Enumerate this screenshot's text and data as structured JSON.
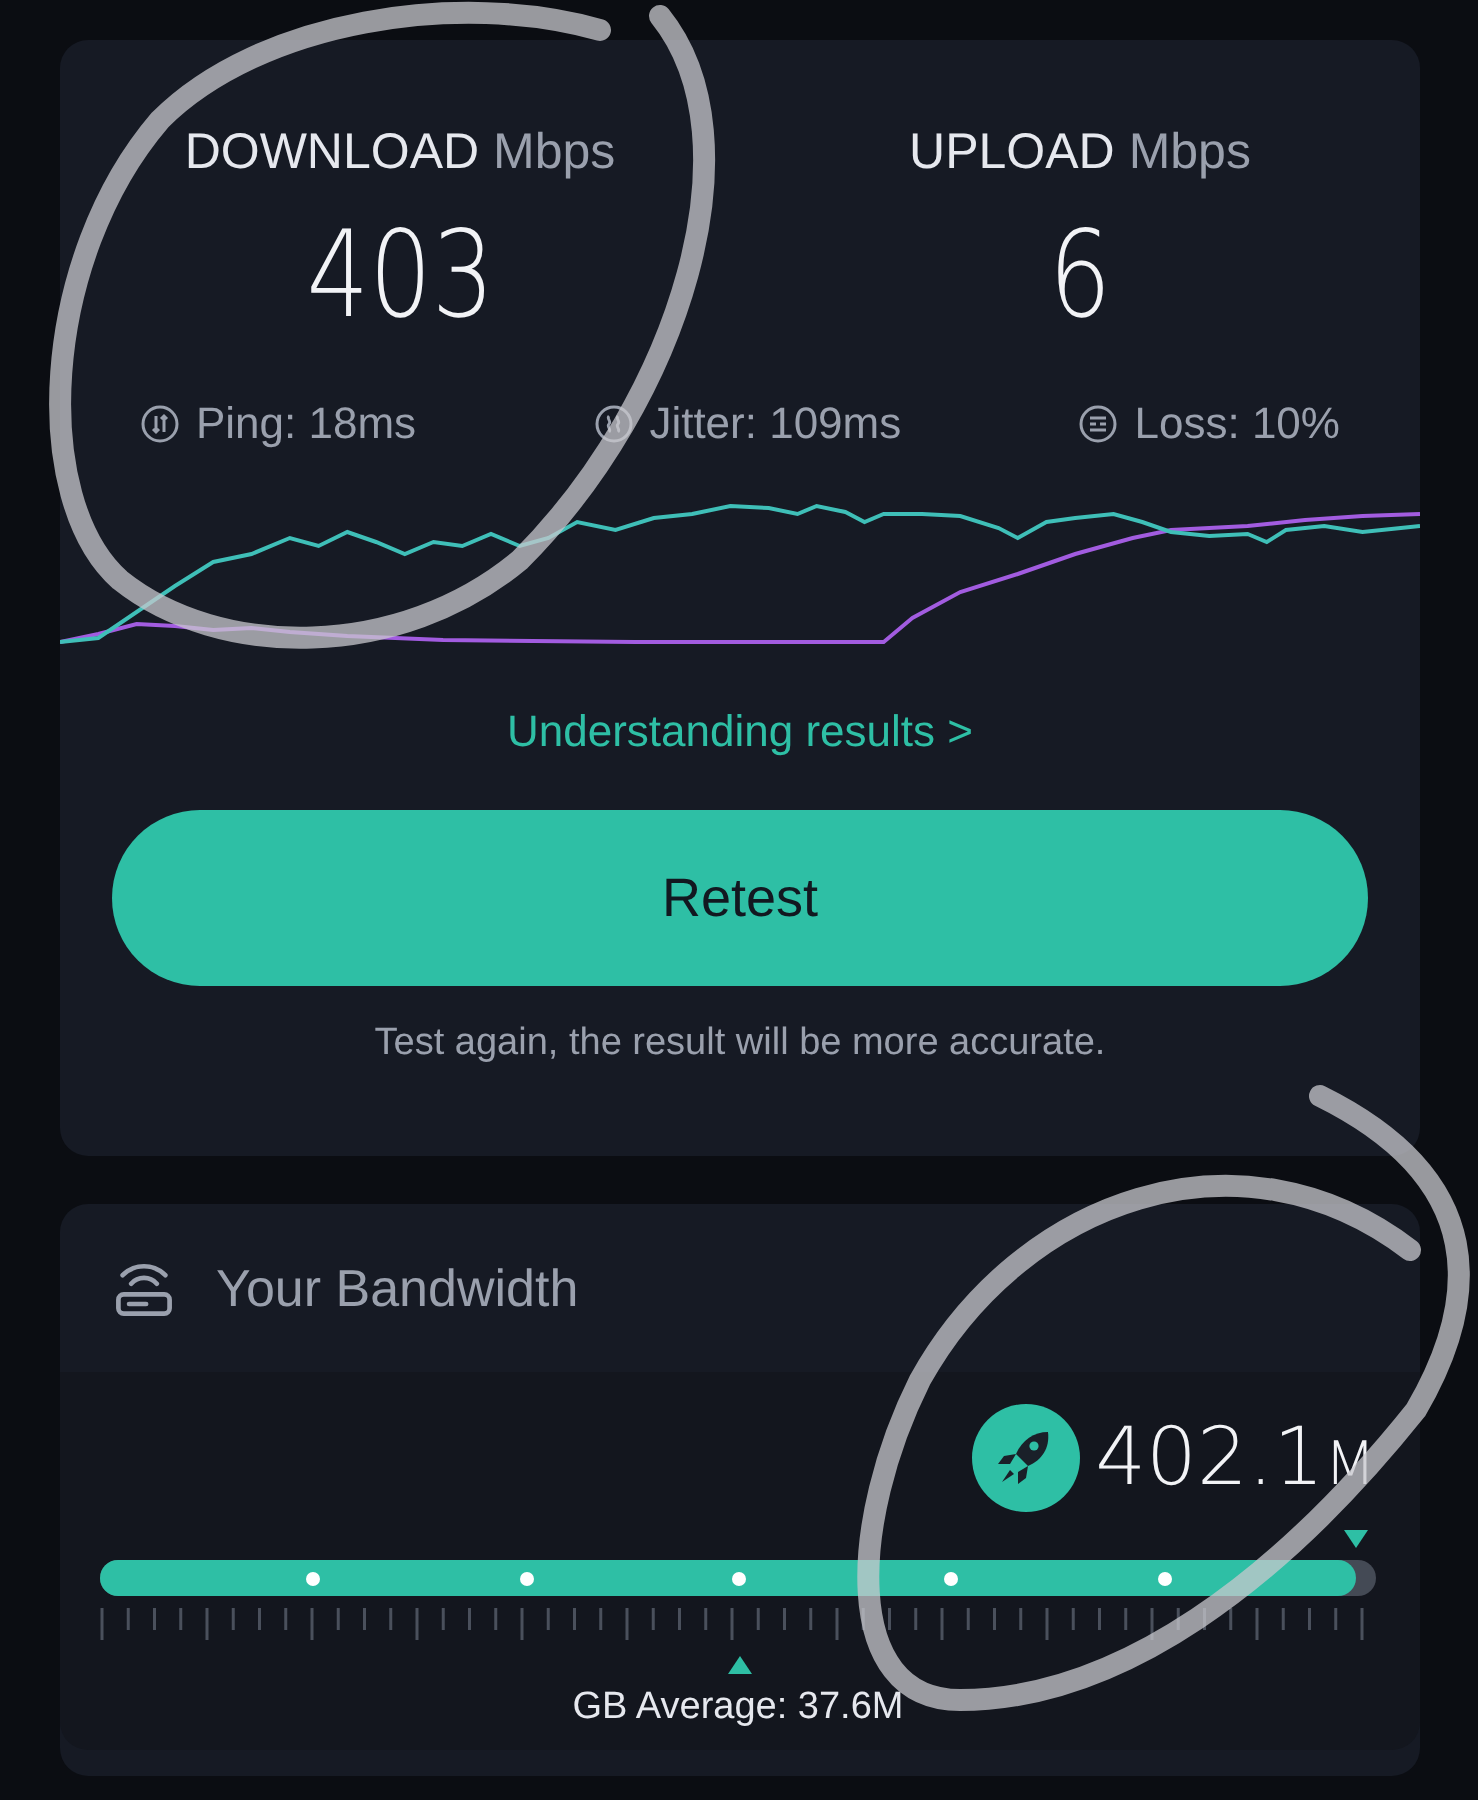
{
  "results": {
    "download": {
      "label": "DOWNLOAD",
      "unit": "Mbps",
      "value": "403"
    },
    "upload": {
      "label": "UPLOAD",
      "unit": "Mbps",
      "value": "6"
    },
    "stats": [
      {
        "kind": "ping",
        "text": "Ping: 18ms"
      },
      {
        "kind": "jitter",
        "text": "Jitter: 109ms"
      },
      {
        "kind": "loss",
        "text": "Loss: 10%"
      }
    ],
    "link": "Understanding results",
    "link_arrow": ">",
    "button": "Retest",
    "hint": "Test again, the result will be more accurate."
  },
  "bandwidth": {
    "title": "Your Bandwidth",
    "speed": "402.1",
    "speed_unit": "M",
    "level": 0.985,
    "average": "GB Average: 37.6M"
  }
}
